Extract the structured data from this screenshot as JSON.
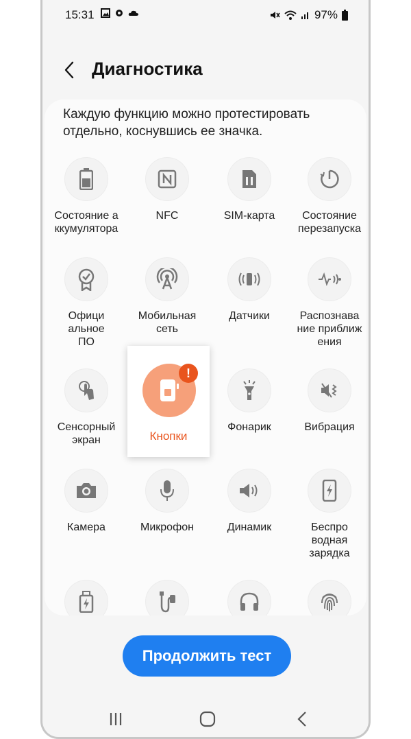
{
  "status": {
    "time": "15:31",
    "battery": "97%"
  },
  "header": {
    "title": "Диагностика"
  },
  "description": "Каждую функцию можно протестировать отдельно, коснувшись ее значка.",
  "grid": {
    "battery": "Состояние а ккумулятора",
    "nfc": "NFC",
    "sim": "SIM-карта",
    "restart": "Состояние перезапуска",
    "software": "Офици альное ПО",
    "mobile_network": "Мобильная сеть",
    "sensors": "Датчики",
    "proximity": "Распознава ние приближ ения",
    "touch": "Сенсорный экран",
    "buttons": "Кнопки",
    "flashlight": "Фонарик",
    "vibration": "Вибрация",
    "camera": "Камера",
    "microphone": "Микрофон",
    "speaker": "Динамик",
    "wireless": "Беспро водная зарядка"
  },
  "lines": {
    "battery": [
      "Состояние а",
      "ккумулятора"
    ],
    "restart": [
      "Состояние",
      "перезапуска"
    ],
    "software": [
      "Офици",
      "альное",
      "ПО"
    ],
    "mobile_network": [
      "Мобильная",
      "сеть"
    ],
    "proximity": [
      "Распознава",
      "ние приближ",
      "ения"
    ],
    "touch": [
      "Сенсорный",
      "экран"
    ],
    "wireless": [
      "Беспро",
      "водная",
      "зарядка"
    ]
  },
  "highlight": {
    "alert": "!"
  },
  "cta_label": "Продолжить тест",
  "colors": {
    "accent": "#1f7ff0",
    "alert": "#e9541d",
    "highlight_bg": "#f6a07a"
  }
}
